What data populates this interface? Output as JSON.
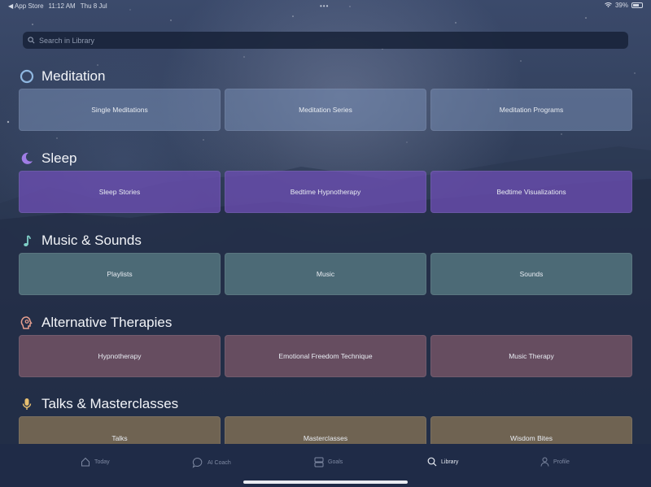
{
  "status_bar": {
    "back_app": "◀ App Store",
    "time": "11:12 AM",
    "date": "Thu 8 Jul",
    "battery": "39%"
  },
  "search": {
    "placeholder": "Search in Library"
  },
  "sections": [
    {
      "title": "Meditation",
      "icon": "ring-icon",
      "items": [
        "Single Meditations",
        "Meditation Series",
        "Meditation Programs"
      ]
    },
    {
      "title": "Sleep",
      "icon": "moon-icon",
      "items": [
        "Sleep Stories",
        "Bedtime Hypnotherapy",
        "Bedtime Visualizations"
      ]
    },
    {
      "title": "Music & Sounds",
      "icon": "music-note-icon",
      "items": [
        "Playlists",
        "Music",
        "Sounds"
      ]
    },
    {
      "title": "Alternative Therapies",
      "icon": "head-icon",
      "items": [
        "Hypnotherapy",
        "Emotional Freedom Technique",
        "Music Therapy"
      ]
    },
    {
      "title": "Talks & Masterclasses",
      "icon": "microphone-icon",
      "items": [
        "Talks",
        "Masterclasses",
        "Wisdom Bites"
      ]
    }
  ],
  "tab_bar": {
    "tabs": [
      {
        "label": "Today",
        "icon": "home-icon"
      },
      {
        "label": "AI Coach",
        "icon": "chat-bubble-icon"
      },
      {
        "label": "Goals",
        "icon": "goals-icon"
      },
      {
        "label": "Library",
        "icon": "search-icon",
        "active": true
      },
      {
        "label": "Profile",
        "icon": "person-icon"
      }
    ]
  },
  "colors": {
    "meditation": "#768cb2",
    "sleep": "#6c4eb2",
    "music": "#567880",
    "alternative": "#705264",
    "talks": "#766854",
    "background": "#1f2b47"
  }
}
